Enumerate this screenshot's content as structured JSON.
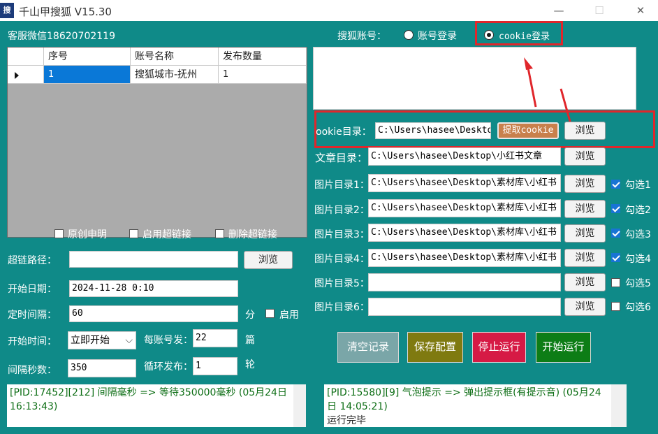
{
  "window": {
    "title": "千山甲搜狐 V15.30",
    "icon_text": "搜",
    "minimize": "—",
    "maximize": "☐",
    "close": "✕"
  },
  "contact": "客服微信18620702119",
  "grid": {
    "headers": [
      "序号",
      "账号名称",
      "发布数量"
    ],
    "rows": [
      {
        "index": "1",
        "name": "搜狐城市-抚州",
        "count": "1"
      }
    ]
  },
  "options": {
    "original": "原创申明",
    "hyperlink": "启用超链接",
    "delete_link": "删除超链接"
  },
  "link_path": {
    "label": "超链路径：",
    "value": "",
    "browse": "浏览"
  },
  "start_date": {
    "label": "开始日期：",
    "value": "2024-11-28 0:10"
  },
  "interval": {
    "label": "定时间隔：",
    "value": "60",
    "unit": "分",
    "enable": "启用"
  },
  "start_time": {
    "label": "开始时间：",
    "value": "立即开始"
  },
  "per_account": {
    "label": "每账号发：",
    "value": "22",
    "unit": "篇"
  },
  "interval_sec": {
    "label": "间隔秒数：",
    "value": "350"
  },
  "loop": {
    "label": "循环发布：",
    "value": "1",
    "unit": "轮"
  },
  "account": {
    "label": "搜狐账号：",
    "option_password": "账号登录",
    "option_cookie": "cookie登录"
  },
  "cookie_dir": {
    "label": "ookie目录：",
    "value": "C:\\Users\\hasee\\Desktop",
    "extract": "提取cookie",
    "browse": "浏览"
  },
  "article_dir": {
    "label": "文章目录：",
    "value": "C:\\Users\\hasee\\Desktop\\小红书文章",
    "browse": "浏览"
  },
  "image_dirs": [
    {
      "label": "图片目录1：",
      "value": "C:\\Users\\hasee\\Desktop\\素材库\\小红书",
      "browse": "浏览",
      "check": "勾选1",
      "checked": true
    },
    {
      "label": "图片目录2：",
      "value": "C:\\Users\\hasee\\Desktop\\素材库\\小红书",
      "browse": "浏览",
      "check": "勾选2",
      "checked": true
    },
    {
      "label": "图片目录3：",
      "value": "C:\\Users\\hasee\\Desktop\\素材库\\小红书",
      "browse": "浏览",
      "check": "勾选3",
      "checked": true
    },
    {
      "label": "图片目录4：",
      "value": "C:\\Users\\hasee\\Desktop\\素材库\\小红书",
      "browse": "浏览",
      "check": "勾选4",
      "checked": true
    },
    {
      "label": "图片目录5：",
      "value": "",
      "browse": "浏览",
      "check": "勾选5",
      "checked": false
    },
    {
      "label": "图片目录6：",
      "value": "",
      "browse": "浏览",
      "check": "勾选6",
      "checked": false
    }
  ],
  "actions": {
    "clear": "清空记录",
    "save": "保存配置",
    "stop": "停止运行",
    "start": "开始运行"
  },
  "colors": {
    "teal": "#0f8a88",
    "clear": "#7aa6a8",
    "save": "#7f7a10",
    "stop": "#d61a45",
    "start": "#0d7d16",
    "highlight": "#e0262b"
  },
  "logs": {
    "left": "[PID:17452][212] 间隔毫秒 => 等待350000毫秒 (05月24日 16:13:43)",
    "right_line1": "[PID:15580][9] 气泡提示 => 弹出提示框(有提示音) (05月24日 14:05:21)",
    "right_line2": "运行完毕"
  }
}
